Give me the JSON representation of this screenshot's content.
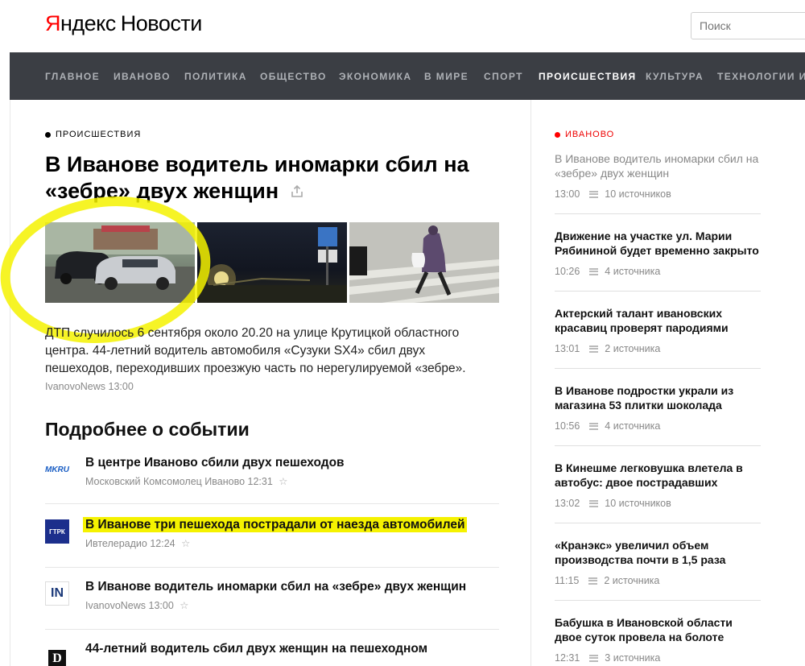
{
  "header": {
    "logo_ya_first": "Я",
    "logo_ya_rest": "ндекс",
    "logo_news": "Новости",
    "search_placeholder": "Поиск"
  },
  "nav": {
    "items": [
      {
        "label": "ГЛАВНОЕ"
      },
      {
        "label": "ИВАНОВО"
      },
      {
        "label": "ПОЛИТИКА"
      },
      {
        "label": "ОБЩЕСТВО"
      },
      {
        "label": "ЭКОНОМИКА"
      },
      {
        "label": "В МИРЕ"
      },
      {
        "label": "СПОРТ"
      },
      {
        "label": "ПРОИСШЕСТВИЯ",
        "active": true
      },
      {
        "label": "КУЛЬТУРА"
      },
      {
        "label": "ТЕХНОЛОГИИ И Н"
      }
    ]
  },
  "article": {
    "rubric": "ПРОИСШЕСТВИЯ",
    "headline": "В Иванове водитель иномарки сбил на «зебре» двух женщин",
    "lead": "ДТП случилось 6 сентября около 20.20 на улице Крутицкой областного центра. 44-летний водитель автомобиля «Сузуки SX4» сбил двух пешеходов, переходивших проезжую часть по нерегулируемой «зебре».",
    "source": "IvanovoNews 13:00",
    "more_title": "Подробнее о событии",
    "stories": [
      {
        "logo": "MKRU",
        "title": "В центре Иваново сбили двух пешеходов",
        "meta": "Московский Комсомолец Иваново 12:31"
      },
      {
        "logo": "ГТРК",
        "title": "В Иванове три пешехода пострадали от наезда автомобилей",
        "meta": "Ивтелерадио 12:24"
      },
      {
        "logo": "IN",
        "title": "В Иванове водитель иномарки сбил на «зебре» двух женщин",
        "meta": "IvanovoNews 13:00"
      },
      {
        "logo": "D",
        "title": "44-летний водитель сбил двух женщин на пешеходном",
        "meta": ""
      }
    ]
  },
  "sidebar": {
    "rubric": "ИВАНОВО",
    "items": [
      {
        "title": "В Иванове водитель иномарки сбил на «зебре» двух женщин",
        "time": "13:00",
        "sources": "10 источников"
      },
      {
        "title": "Движение на участке ул. Марии Рябининой будет временно закрыто",
        "time": "10:26",
        "sources": "4 источника"
      },
      {
        "title": "Актерский талант ивановских красавиц проверят пародиями",
        "time": "13:01",
        "sources": "2 источника"
      },
      {
        "title": "В Иванове подростки украли из магазина 53 плитки шоколада",
        "time": "10:56",
        "sources": "4 источника"
      },
      {
        "title": "В Кинешме легковушка влетела в автобус: двое пострадавших",
        "time": "13:02",
        "sources": "10 источников"
      },
      {
        "title": "«Кранэкс» увеличил объем производства почти в 1,5 раза",
        "time": "11:15",
        "sources": "2 источника"
      },
      {
        "title": "Бабушка в Ивановской области двое суток провела на болоте",
        "time": "12:31",
        "sources": "3 источника"
      }
    ]
  },
  "colors": {
    "nav_bg": "#3b3e44",
    "logo_red": "#ff0000",
    "highlight": "#f5f200"
  }
}
